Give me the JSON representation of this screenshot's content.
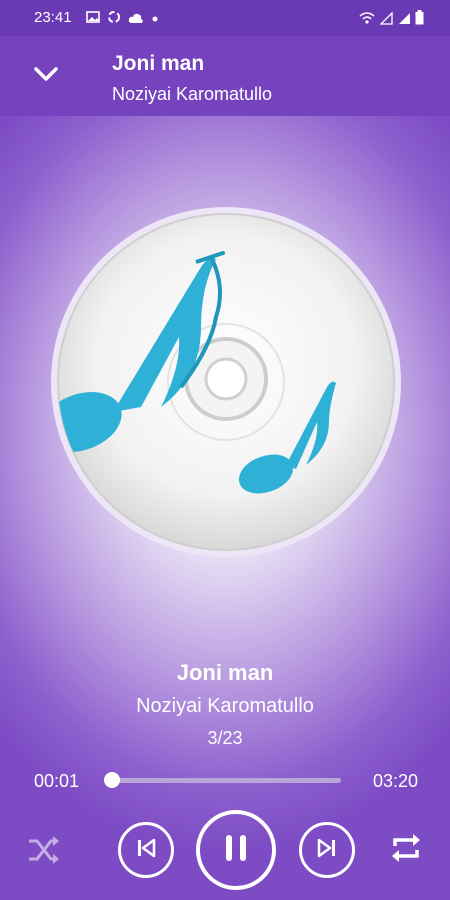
{
  "status_bar": {
    "time": "23:41",
    "icons": [
      "image-icon",
      "sync-icon",
      "cloud-icon",
      "dot-icon",
      "wifi-icon",
      "signal-icon",
      "signal-icon",
      "battery-icon"
    ]
  },
  "header": {
    "title": "Joni man",
    "subtitle": "Noziyai Karomatullo",
    "back_icon": "chevron-down-icon"
  },
  "now_playing": {
    "title": "Joni man",
    "artist": "Noziyai Karomatullo",
    "track_index": "3/23"
  },
  "progress": {
    "current": "00:01",
    "total": "03:20",
    "fraction": 0.005
  },
  "controls": {
    "shuffle_icon": "shuffle-icon",
    "previous_icon": "skip-previous-icon",
    "play_pause_icon": "pause-icon",
    "next_icon": "skip-next-icon",
    "repeat_icon": "repeat-icon"
  },
  "colors": {
    "accent": "#7643bf",
    "status_bar": "#6a3ab5",
    "note_blue": "#2fb0d6"
  }
}
